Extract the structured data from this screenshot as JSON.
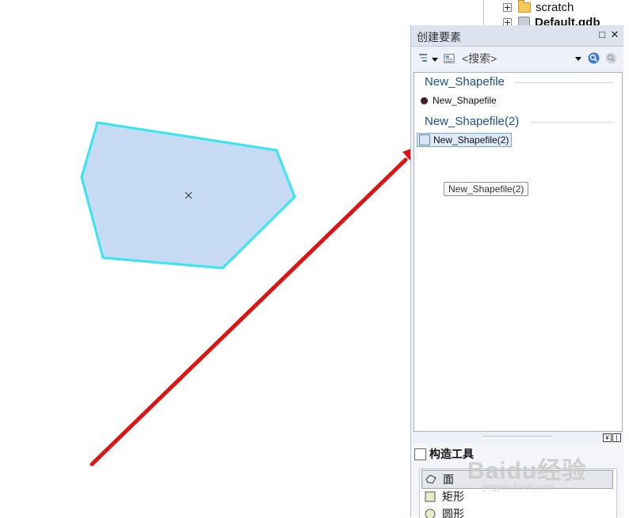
{
  "catalog_tree": {
    "items": [
      {
        "label": "scratch",
        "icon": "folder-icon"
      },
      {
        "label": "Default.gdb",
        "icon": "geodatabase-icon"
      }
    ]
  },
  "map": {
    "polygon_fill": "#c6dbf3",
    "polygon_outline": "#35e6f0",
    "arrow_color": "#e01313"
  },
  "create_features": {
    "title": "创建要素",
    "search_placeholder": "<搜索>",
    "groups": [
      {
        "name": "New_Shapefile",
        "template": "New_Shapefile",
        "symbol": "point"
      },
      {
        "name": "New_Shapefile(2)",
        "template": "New_Shapefile(2)",
        "symbol": "polygon"
      }
    ],
    "tooltip": "New_Shapefile(2)"
  },
  "construction_tools": {
    "title": "构造工具",
    "tools": [
      {
        "label": "面",
        "icon": "polygon-tool-icon"
      },
      {
        "label": "矩形",
        "icon": "rectangle-tool-icon"
      },
      {
        "label": "圆形",
        "icon": "circle-tool-icon"
      }
    ]
  },
  "watermark": {
    "logo": "Baidu经验",
    "url": "jingyan.baidu.com"
  },
  "colors": {
    "accent_blue": "#1f4e8c",
    "selection": "#dfeaf8"
  }
}
